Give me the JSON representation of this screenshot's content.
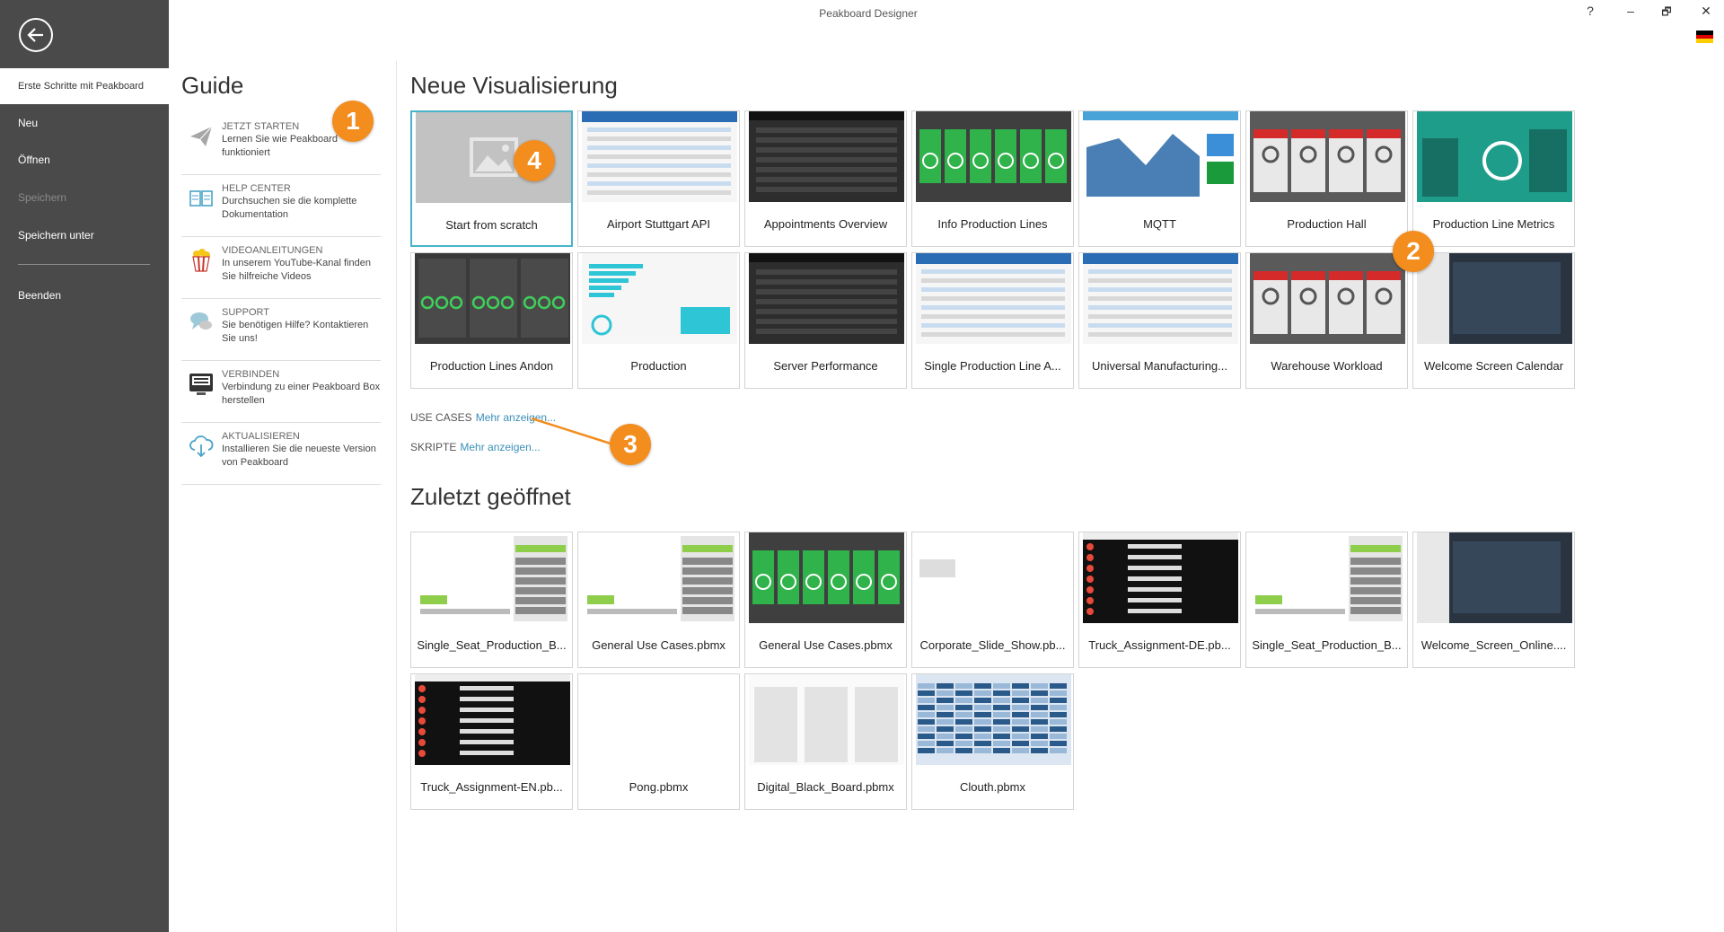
{
  "window": {
    "title": "Peakboard Designer",
    "help": "?",
    "minimize": "–",
    "restore": "🗗",
    "close": "✕"
  },
  "sidebar": {
    "items": [
      {
        "label": "Erste Schritte mit Peakboard",
        "state": "active"
      },
      {
        "label": "Neu",
        "state": "normal"
      },
      {
        "label": "Öffnen",
        "state": "normal"
      },
      {
        "label": "Speichern",
        "state": "disabled"
      },
      {
        "label": "Speichern unter",
        "state": "normal"
      },
      {
        "label": "Beenden",
        "state": "normal"
      }
    ]
  },
  "guide": {
    "title": "Guide",
    "items": [
      {
        "head": "JETZT STARTEN",
        "text": "Lernen Sie wie Peakboard funktioniert",
        "icon": "paper-plane-icon"
      },
      {
        "head": "HELP CENTER",
        "text": "Durchsuchen sie die komplette Dokumentation",
        "icon": "book-icon"
      },
      {
        "head": "VIDEOANLEITUNGEN",
        "text": "In unserem YouTube-Kanal finden Sie hilfreiche Videos",
        "icon": "popcorn-icon"
      },
      {
        "head": "SUPPORT",
        "text": "Sie benötigen Hilfe? Kontaktieren Sie uns!",
        "icon": "chat-icon"
      },
      {
        "head": "VERBINDEN",
        "text": "Verbindung zu einer Peakboard Box herstellen",
        "icon": "peakboard-box-icon"
      },
      {
        "head": "AKTUALISIEREN",
        "text": "Installieren Sie die neueste Version von Peakboard",
        "icon": "cloud-download-icon"
      }
    ]
  },
  "new_viz": {
    "title": "Neue Visualisierung",
    "templates": [
      {
        "label": "Start from scratch",
        "theme": "scratch"
      },
      {
        "label": "Airport Stuttgart API",
        "theme": "white"
      },
      {
        "label": "Appointments Overview",
        "theme": "dark"
      },
      {
        "label": "Info Production Lines",
        "theme": "green"
      },
      {
        "label": "MQTT",
        "theme": "chart"
      },
      {
        "label": "Production Hall",
        "theme": "grayred"
      },
      {
        "label": "Production Line Metrics",
        "theme": "teal"
      },
      {
        "label": "Production Lines Andon",
        "theme": "darkgreen"
      },
      {
        "label": "Production",
        "theme": "bluebars"
      },
      {
        "label": "Server Performance",
        "theme": "dark"
      },
      {
        "label": "Single Production Line A...",
        "theme": "white"
      },
      {
        "label": "Universal Manufacturing...",
        "theme": "white"
      },
      {
        "label": "Warehouse Workload",
        "theme": "grayred"
      },
      {
        "label": "Welcome Screen Calendar",
        "theme": "darkblue"
      }
    ]
  },
  "use_cases": {
    "label": "USE CASES",
    "link": "Mehr anzeigen..."
  },
  "skripte": {
    "label": "SKRIPTE",
    "link": "Mehr anzeigen..."
  },
  "recent": {
    "title": "Zuletzt geöffnet",
    "files": [
      {
        "label": "Single_Seat_Production_B...",
        "theme": "andon"
      },
      {
        "label": "General Use Cases.pbmx",
        "theme": "andon"
      },
      {
        "label": "General Use Cases.pbmx",
        "theme": "green"
      },
      {
        "label": "Corporate_Slide_Show.pb...",
        "theme": "pasta"
      },
      {
        "label": "Truck_Assignment-DE.pb...",
        "theme": "black"
      },
      {
        "label": "Single_Seat_Production_B...",
        "theme": "andon"
      },
      {
        "label": "Welcome_Screen_Online....",
        "theme": "darkblue"
      },
      {
        "label": "Truck_Assignment-EN.pb...",
        "theme": "black"
      },
      {
        "label": "Pong.pbmx",
        "theme": "blank"
      },
      {
        "label": "Digital_Black_Board.pbmx",
        "theme": "board"
      },
      {
        "label": "Clouth.pbmx",
        "theme": "grid"
      }
    ]
  },
  "markers": [
    "1",
    "2",
    "3",
    "4"
  ],
  "colors": {
    "sidebar": "#4a4a4a",
    "accent": "#48b3c9",
    "marker": "#f28d1e",
    "link": "#3a8fb8"
  }
}
